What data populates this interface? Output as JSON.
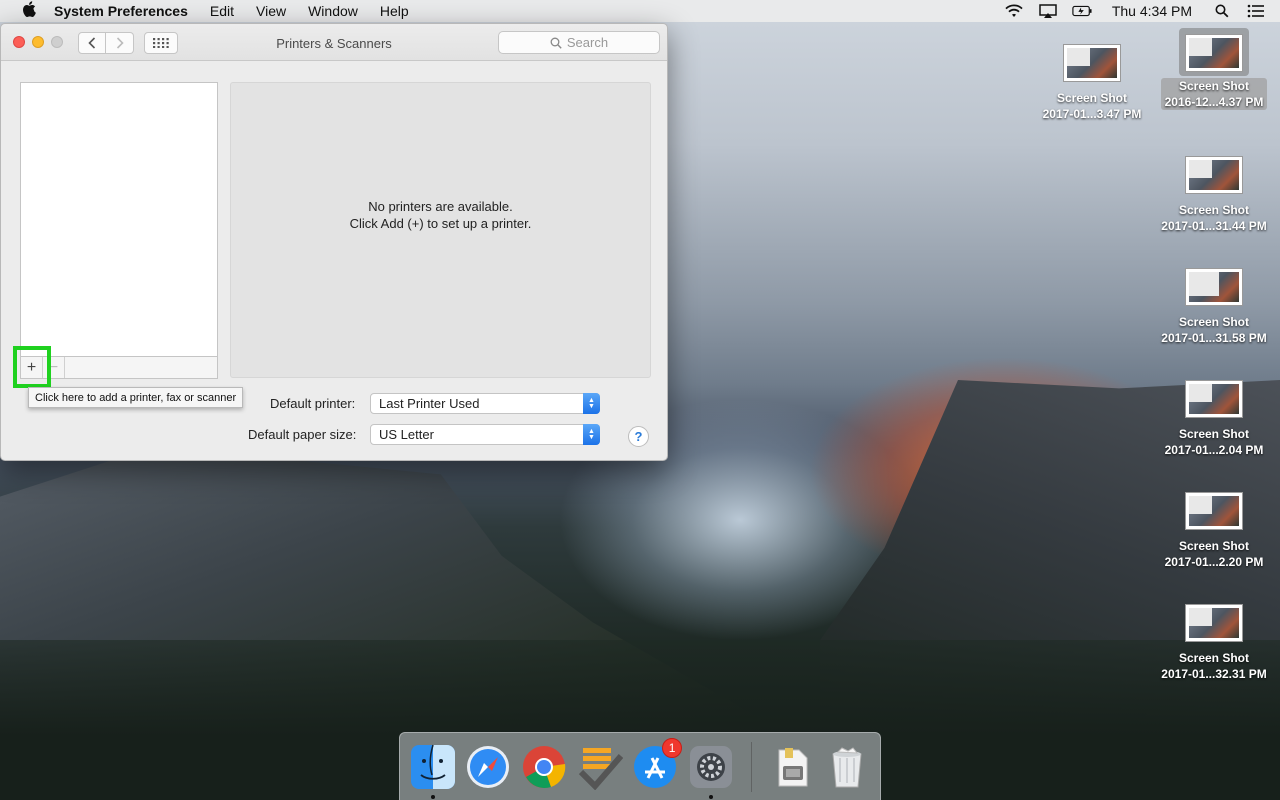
{
  "menubar": {
    "app_name": "System Preferences",
    "items": [
      "Edit",
      "View",
      "Window",
      "Help"
    ],
    "clock": "Thu 4:34 PM"
  },
  "window": {
    "title": "Printers & Scanners",
    "search_placeholder": "Search",
    "empty_message_line1": "No printers are available.",
    "empty_message_line2": "Click Add (+) to set up a printer.",
    "add_button": "+",
    "remove_button": "−",
    "tooltip": "Click here to add a printer, fax or scanner",
    "default_printer_label": "Default printer:",
    "default_printer_value": "Last Printer Used",
    "paper_size_label": "Default paper size:",
    "paper_size_value": "US Letter",
    "help_button": "?"
  },
  "desktop_icons": [
    {
      "line1": "Screen Shot",
      "line2": "2017-01...3.47 PM"
    },
    {
      "line1": "Screen Shot",
      "line2": "2016-12...4.37 PM"
    },
    {
      "line1": "Screen Shot",
      "line2": "2017-01...31.44 PM"
    },
    {
      "line1": "Screen Shot",
      "line2": "2017-01...31.58 PM"
    },
    {
      "line1": "Screen Shot",
      "line2": "2017-01...2.04 PM"
    },
    {
      "line1": "Screen Shot",
      "line2": "2017-01...2.20 PM"
    },
    {
      "line1": "Screen Shot",
      "line2": "2017-01...32.31 PM"
    }
  ],
  "dock": {
    "apps": [
      "finder-icon",
      "safari-icon",
      "chrome-icon",
      "todo-icon",
      "app-store-icon",
      "system-preferences-icon",
      "downloads-stack-icon",
      "trash-icon"
    ],
    "app_store_badge": "1"
  },
  "colors": {
    "highlight": "#1fd11f",
    "accent": "#1b72e8"
  }
}
